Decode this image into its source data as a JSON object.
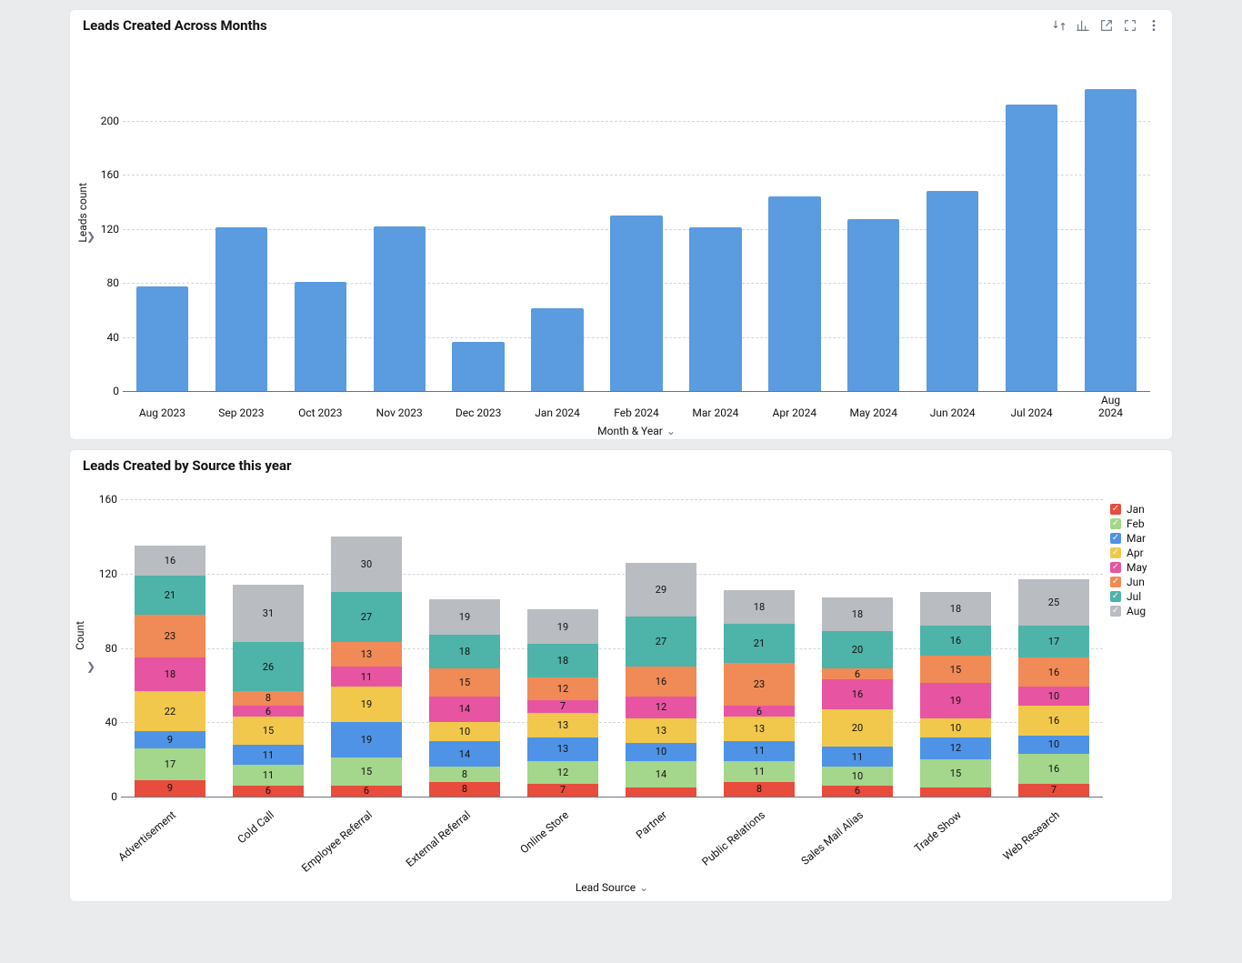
{
  "chart1": {
    "title": "Leads Created Across Months",
    "ylabel": "Leads count",
    "xlabel": "Month & Year",
    "yticks": [
      0,
      40,
      80,
      120,
      160,
      200
    ],
    "ymax": 240
  },
  "chart2": {
    "title": "Leads Created by Source this year",
    "ylabel": "Count",
    "xlabel": "Lead Source",
    "yticks": [
      0,
      40,
      80,
      120,
      160
    ],
    "ymax": 160
  },
  "chart_data": [
    {
      "id": "leads_by_month",
      "type": "bar",
      "title": "Leads Created Across Months",
      "xlabel": "Month & Year",
      "ylabel": "Leads count",
      "ylim": [
        0,
        240
      ],
      "categories": [
        "Aug 2023",
        "Sep 2023",
        "Oct 2023",
        "Nov 2023",
        "Dec 2023",
        "Jan 2024",
        "Feb 2024",
        "Mar 2024",
        "Apr 2024",
        "May 2024",
        "Jun 2024",
        "Jul 2024",
        "Aug 2024"
      ],
      "values": [
        77,
        121,
        81,
        122,
        36,
        61,
        130,
        121,
        144,
        127,
        148,
        212,
        223
      ],
      "bar_color": "#5b9bdf"
    },
    {
      "id": "leads_by_source",
      "type": "stacked_bar",
      "title": "Leads Created by Source this year",
      "xlabel": "Lead Source",
      "ylabel": "Count",
      "ylim": [
        0,
        160
      ],
      "categories": [
        "Advertisement",
        "Cold Call",
        "Employee Referral",
        "External Referral",
        "Online Store",
        "Partner",
        "Public Relations",
        "Sales Mail Alias",
        "Trade Show",
        "Web Research"
      ],
      "series": [
        {
          "name": "Jan",
          "color": "#e74c3c",
          "values": [
            9,
            6,
            6,
            8,
            7,
            5,
            8,
            6,
            5,
            7
          ]
        },
        {
          "name": "Feb",
          "color": "#a4d68b",
          "values": [
            17,
            11,
            15,
            8,
            12,
            14,
            11,
            10,
            15,
            16
          ]
        },
        {
          "name": "Mar",
          "color": "#4e93e6",
          "values": [
            9,
            11,
            19,
            14,
            13,
            10,
            11,
            11,
            12,
            10
          ]
        },
        {
          "name": "Apr",
          "color": "#f1c84c",
          "values": [
            22,
            15,
            19,
            10,
            13,
            13,
            13,
            20,
            10,
            16
          ]
        },
        {
          "name": "May",
          "color": "#e754a1",
          "values": [
            18,
            6,
            11,
            14,
            7,
            12,
            6,
            16,
            19,
            10
          ]
        },
        {
          "name": "Jun",
          "color": "#f08a56",
          "values": [
            23,
            8,
            13,
            15,
            12,
            16,
            23,
            6,
            15,
            16
          ]
        },
        {
          "name": "Jul",
          "color": "#4eb3a9",
          "values": [
            21,
            26,
            27,
            18,
            18,
            27,
            21,
            20,
            16,
            17
          ]
        },
        {
          "name": "Aug",
          "color": "#b9bcc0",
          "values": [
            16,
            31,
            30,
            19,
            19,
            29,
            18,
            18,
            18,
            25
          ]
        }
      ]
    }
  ]
}
